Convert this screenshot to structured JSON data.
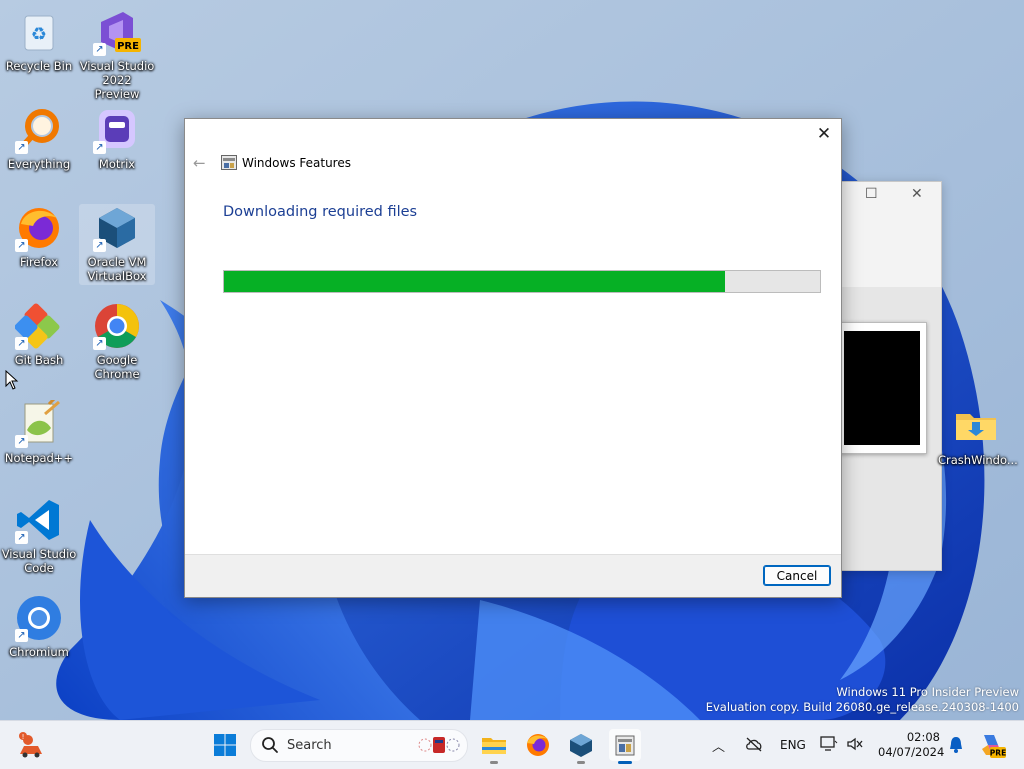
{
  "desktop": {
    "icons": [
      {
        "label_1": "Recycle Bin",
        "label_2": ""
      },
      {
        "label_1": "Visual Studio",
        "label_2": "2022 Preview",
        "badge": "PRE"
      },
      {
        "label_1": "Everything",
        "label_2": ""
      },
      {
        "label_1": "Motrix",
        "label_2": ""
      },
      {
        "label_1": "Firefox",
        "label_2": ""
      },
      {
        "label_1": "Oracle VM",
        "label_2": "VirtualBox"
      },
      {
        "label_1": "Git Bash",
        "label_2": ""
      },
      {
        "label_1": "Google",
        "label_2": "Chrome"
      },
      {
        "label_1": "Notepad++",
        "label_2": ""
      },
      {
        "label_1": "Visual Studio",
        "label_2": "Code"
      },
      {
        "label_1": "Chromium",
        "label_2": ""
      },
      {
        "label_1": "CrashWindo...",
        "label_2": ""
      }
    ]
  },
  "dialog": {
    "title": "Windows Features",
    "heading": "Downloading required files",
    "progress": 0.84,
    "cancel_label": "Cancel",
    "close_glyph": "✕",
    "back_glyph": "←"
  },
  "watermark": {
    "line1": "Windows 11 Pro Insider Preview",
    "line2": "Evaluation copy. Build 26080.ge_release.240308-1400"
  },
  "taskbar": {
    "search_placeholder": "Search",
    "tray": {
      "language": "ENG",
      "time": "02:08",
      "date": "04/07/2024",
      "copilot_badge": "PRE"
    }
  },
  "colors": {
    "progress_fill": "#06b025",
    "heading": "#1c3f94",
    "accent": "#0067c0"
  }
}
